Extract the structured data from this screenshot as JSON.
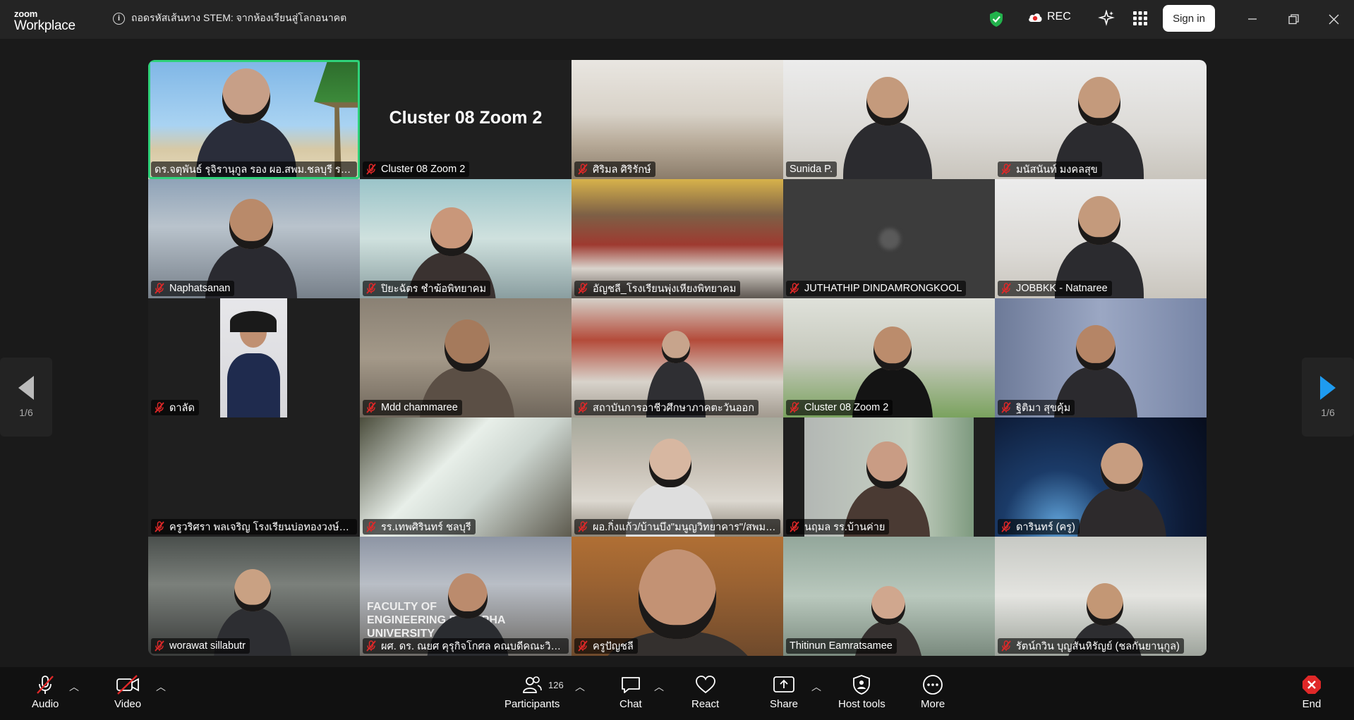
{
  "app": {
    "logo_line1": "zoom",
    "logo_line2": "Workplace"
  },
  "meeting": {
    "title": "ถอดรหัสเส้นทาง STEM: จากห้องเรียนสู่โลกอนาคต"
  },
  "header": {
    "rec_label": "REC",
    "signin_label": "Sign in"
  },
  "tiles": [
    {
      "name": "ดร.จตุพันธ์ รุจิรานุกูล รอง ผอ.สพม.ชลบุรี ระยอง",
      "muted": false,
      "video": "beach"
    },
    {
      "name": "Cluster 08 Zoom 2",
      "muted": true,
      "video": "text",
      "display": "Cluster 08 Zoom 2"
    },
    {
      "name": "ศิริมล ศิริรักษ์",
      "muted": true,
      "video": "office"
    },
    {
      "name": "Sunida P.",
      "muted": false,
      "video": "person-light"
    },
    {
      "name": "มนัสนันท์ มงคลสุข",
      "muted": true,
      "video": "person-light"
    },
    {
      "name": "Naphatsanan",
      "muted": true,
      "video": "person-blur"
    },
    {
      "name": "ปิยะฉัตร ชำฆ้อพิทยาคม",
      "muted": true,
      "video": "person-class"
    },
    {
      "name": "อัญชลี_โรงเรียนพุ่งเหียงพิทยาคม",
      "muted": true,
      "video": "meeting-room"
    },
    {
      "name": "JUTHATHIP DINDAMRONGKOOL",
      "muted": true,
      "video": "off"
    },
    {
      "name": "JOBBKK - Natnaree",
      "muted": true,
      "video": "person-light"
    },
    {
      "name": "ดาลัด",
      "muted": true,
      "video": "portrait"
    },
    {
      "name": "Mdd chammaree",
      "muted": true,
      "video": "person-dim"
    },
    {
      "name": "สถาบันการอาชีวศึกษาภาคตะวันออก",
      "muted": true,
      "video": "desk"
    },
    {
      "name": "Cluster 08 Zoom 2",
      "muted": true,
      "video": "person-room"
    },
    {
      "name": "ฐิติมา สุขคุ้ม",
      "muted": true,
      "video": "person-curtain"
    },
    {
      "name": "ครูวริศรา พลเจริญ โรงเรียนบ่อทองวงษ์จันทร์...",
      "muted": true,
      "video": "off-dark"
    },
    {
      "name": "รร.เทพศิรินทร์ ชลบุรี",
      "muted": true,
      "video": "bright"
    },
    {
      "name": "ผอ.กิ่งแก้ว/บ้านบึง\"มนูญวิทยาคาร\"/สพม.ช...",
      "muted": true,
      "video": "person-office"
    },
    {
      "name": "นฤมล รร.บ้านค่าย",
      "muted": true,
      "video": "person-window"
    },
    {
      "name": "ดารินทร์ (ครู)",
      "muted": true,
      "video": "space"
    },
    {
      "name": "worawat sillabutr",
      "muted": true,
      "video": "person-blur2"
    },
    {
      "name": "ผศ. ดร. ณยศ คุรุกิจโกศล คณบดีคณะวิศวก...",
      "muted": true,
      "video": "faculty",
      "sign": "FACULTY OF ENGINEERING BURAPHA UNIVERSITY"
    },
    {
      "name": "ครูปัญชลี",
      "muted": true,
      "video": "closeup"
    },
    {
      "name": "Thitinun Eamratsamee",
      "muted": false,
      "video": "person-green"
    },
    {
      "name": "รัตน์กวิน บุญสันหิรัญย์ (ชลกันยานุกูล)",
      "muted": true,
      "video": "person-office2"
    }
  ],
  "pager": {
    "left_count": "1/6",
    "right_count": "1/6"
  },
  "toolbar": {
    "audio": "Audio",
    "video": "Video",
    "participants": "Participants",
    "participants_count": "126",
    "chat": "Chat",
    "react": "React",
    "share": "Share",
    "host_tools": "Host tools",
    "more": "More",
    "end": "End"
  },
  "colors": {
    "active_border": "#2fd27a",
    "mute_red": "#e02828",
    "pager_arrow": "#1e9bf0",
    "shield_green": "#22b24c"
  }
}
